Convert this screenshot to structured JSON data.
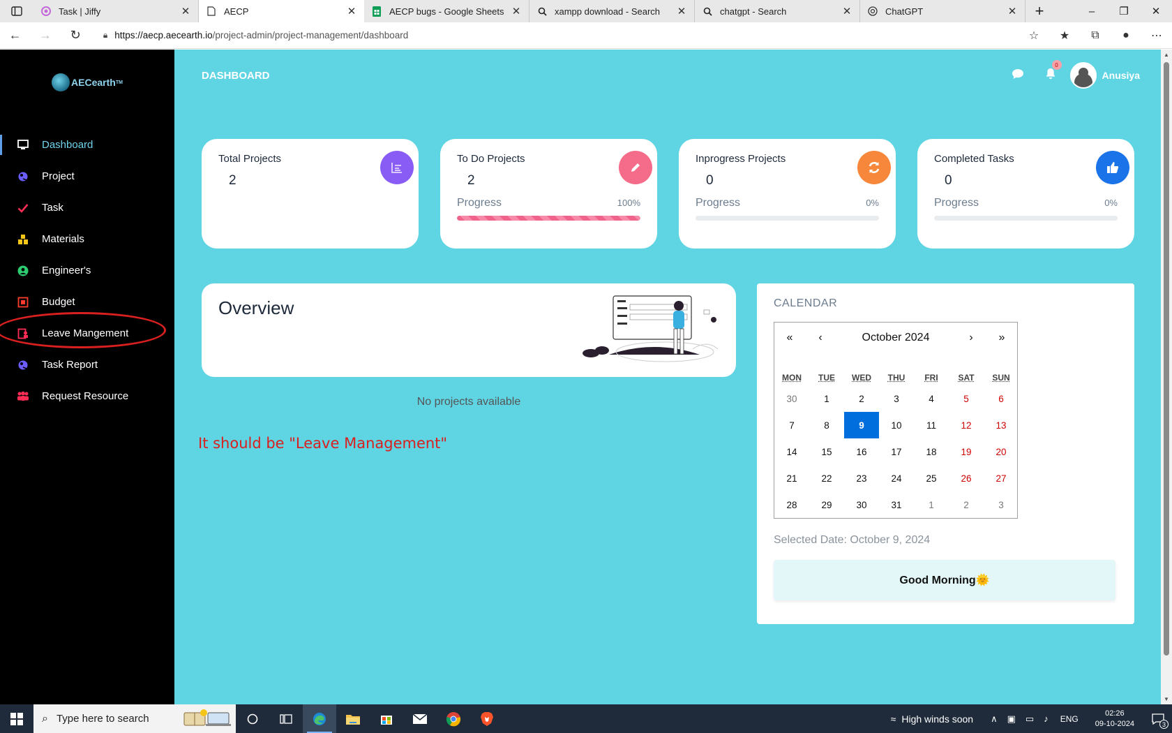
{
  "browser": {
    "tabs": [
      {
        "title": "Task | Jiffy",
        "icon": "jiffy-icon",
        "active": false
      },
      {
        "title": "AECP",
        "icon": "page-icon",
        "active": true
      },
      {
        "title": "AECP bugs - Google Sheets",
        "icon": "sheets-icon",
        "active": false
      },
      {
        "title": "xampp download - Search",
        "icon": "search-icon",
        "active": false
      },
      {
        "title": "chatgpt - Search",
        "icon": "search-icon",
        "active": false
      },
      {
        "title": "ChatGPT",
        "icon": "chatgpt-icon",
        "active": false
      }
    ],
    "url_scheme_host": "https://aecp.aecearth.io",
    "url_path": "/project-admin/project-management/dashboard"
  },
  "sidebar": {
    "logo_text": "AECearth",
    "logo_tm": "TM",
    "items": [
      {
        "label": "Dashboard",
        "icon": "monitor-icon",
        "icon_color": "#ffffff",
        "active": true
      },
      {
        "label": "Project",
        "icon": "project-icon",
        "icon_color": "#6a5cff",
        "active": false
      },
      {
        "label": "Task",
        "icon": "check-icon",
        "icon_color": "#ff2d55",
        "active": false
      },
      {
        "label": "Materials",
        "icon": "materials-icon",
        "icon_color": "#f5c518",
        "active": false
      },
      {
        "label": "Engineer's",
        "icon": "user-circle-icon",
        "icon_color": "#2ecc71",
        "active": false
      },
      {
        "label": "Budget",
        "icon": "budget-icon",
        "icon_color": "#ff3b30",
        "active": false
      },
      {
        "label": "Leave Mangement",
        "icon": "leave-icon",
        "icon_color": "#ff2d55",
        "active": false
      },
      {
        "label": "Task Report",
        "icon": "report-icon",
        "icon_color": "#6a5cff",
        "active": false
      },
      {
        "label": "Request Resource",
        "icon": "people-icon",
        "icon_color": "#ff2d55",
        "active": false
      }
    ]
  },
  "header": {
    "title": "DASHBOARD",
    "notification_count": "0",
    "username": "Anusiya"
  },
  "cards": [
    {
      "title": "Total Projects",
      "value": "2",
      "icon": "list-icon",
      "icon_color": "#8a5cf6",
      "has_progress": false
    },
    {
      "title": "To Do Projects",
      "value": "2",
      "icon": "pencil-icon",
      "icon_color": "#f56b8a",
      "has_progress": true,
      "progress_label": "Progress",
      "progress_text": "100%",
      "progress": 1.0
    },
    {
      "title": "Inprogress Projects",
      "value": "0",
      "icon": "refresh-icon",
      "icon_color": "#f7873a",
      "has_progress": true,
      "progress_label": "Progress",
      "progress_text": "0%",
      "progress": 0.0
    },
    {
      "title": "Completed Tasks",
      "value": "0",
      "icon": "thumbs-up-icon",
      "icon_color": "#1a73e8",
      "has_progress": true,
      "progress_label": "Progress",
      "progress_text": "0%",
      "progress": 0.0
    }
  ],
  "overview": {
    "title": "Overview",
    "empty_text": "No projects available"
  },
  "annotation": {
    "text": "It should be \"Leave Management\"",
    "color": "#d9201f"
  },
  "calendar": {
    "heading": "CALENDAR",
    "nav": {
      "prev_year": "«",
      "prev_month": "‹",
      "month_label": "October 2024",
      "next_month": "›",
      "next_year": "»"
    },
    "weekdays": [
      "MON",
      "TUE",
      "WED",
      "THU",
      "FRI",
      "SAT",
      "SUN"
    ],
    "weeks": [
      [
        "30",
        "1",
        "2",
        "3",
        "4",
        "5",
        "6"
      ],
      [
        "7",
        "8",
        "9",
        "10",
        "11",
        "12",
        "13"
      ],
      [
        "14",
        "15",
        "16",
        "17",
        "18",
        "19",
        "20"
      ],
      [
        "21",
        "22",
        "23",
        "24",
        "25",
        "26",
        "27"
      ],
      [
        "28",
        "29",
        "30",
        "31",
        "1",
        "2",
        "3"
      ]
    ],
    "selected_day": "9",
    "selected_text": "Selected Date: October 9, 2024",
    "greeting": "Good Morning🌞"
  },
  "taskbar": {
    "search_placeholder": "Type here to search",
    "weather": "High winds soon",
    "language": "ENG",
    "time": "02:26",
    "date": "09-10-2024",
    "notification_count": "3"
  }
}
